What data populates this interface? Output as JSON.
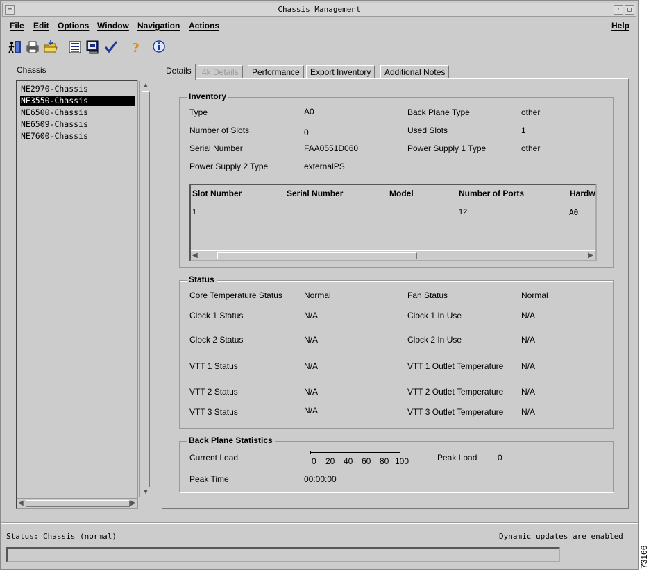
{
  "window": {
    "title": "Chassis Management"
  },
  "menu": {
    "file": "File",
    "edit": "Edit",
    "options": "Options",
    "window": "Window",
    "navigation": "Navigation",
    "actions": "Actions",
    "help": "Help"
  },
  "toolbar": {
    "icons": [
      "exit-icon",
      "print-icon",
      "folder-icon",
      "list-icon",
      "monitor-icon",
      "checkmark-icon",
      "help-icon",
      "info-icon"
    ]
  },
  "chassis": {
    "label": "Chassis",
    "items": [
      "NE2970-Chassis",
      "NE3550-Chassis",
      "NE6500-Chassis",
      "NE6509-Chassis",
      "NE7600-Chassis"
    ],
    "selected": "NE3550-Chassis"
  },
  "tabs": [
    "Details",
    "4k Details",
    "Performance",
    "Export Inventory",
    "Additional Notes"
  ],
  "inventory": {
    "title": "Inventory",
    "type_label": "Type",
    "type_value": "A0",
    "backplane_label": "Back Plane Type",
    "backplane_value": "other",
    "slots_label": "Number of Slots",
    "slots_value": "0",
    "used_label": "Used Slots",
    "used_value": "1",
    "serial_label": "Serial Number",
    "serial_value": "FAA0551D060",
    "ps1_label": "Power Supply 1 Type",
    "ps1_value": "other",
    "ps2_label": "Power Supply 2 Type",
    "ps2_value": "externalPS",
    "table": {
      "headers": [
        "Slot Number",
        "Serial Number",
        "Model",
        "Number of Ports",
        "Hardw"
      ],
      "rows": [
        [
          "1",
          "",
          "",
          "12",
          "A0"
        ]
      ]
    }
  },
  "status": {
    "title": "Status",
    "core_temp_label": "Core Temperature Status",
    "core_temp_value": "Normal",
    "fan_label": "Fan Status",
    "fan_value": "Normal",
    "clock1_label": "Clock 1 Status",
    "clock1_value": "N/A",
    "clock1_use_label": "Clock 1 In Use",
    "clock1_use_value": "N/A",
    "clock2_label": "Clock 2 Status",
    "clock2_value": "N/A",
    "clock2_use_label": "Clock 2 In Use",
    "clock2_use_value": "N/A",
    "vtt1_label": "VTT 1 Status",
    "vtt1_value": "N/A",
    "vtt1_out_label": "VTT 1 Outlet Temperature",
    "vtt1_out_value": "N/A",
    "vtt2_label": "VTT 2 Status",
    "vtt2_value": "N/A",
    "vtt2_out_label": "VTT 2 Outlet Temperature",
    "vtt2_out_value": "N/A",
    "vtt3_label": "VTT 3 Status",
    "vtt3_value": "N/A",
    "vtt3_out_label": "VTT 3 Outlet Temperature",
    "vtt3_out_value": "N/A"
  },
  "backplane": {
    "title": "Back Plane Statistics",
    "current_load_label": "Current Load",
    "scale": [
      "0",
      "20",
      "40",
      "60",
      "80",
      "100"
    ],
    "peak_load_label": "Peak Load",
    "peak_load_value": "0",
    "peak_time_label": "Peak Time",
    "peak_time_value": "00:00:00"
  },
  "statusbar": {
    "left": "Status: Chassis (normal)",
    "right": "Dynamic updates are enabled"
  },
  "figure_code": "73166"
}
